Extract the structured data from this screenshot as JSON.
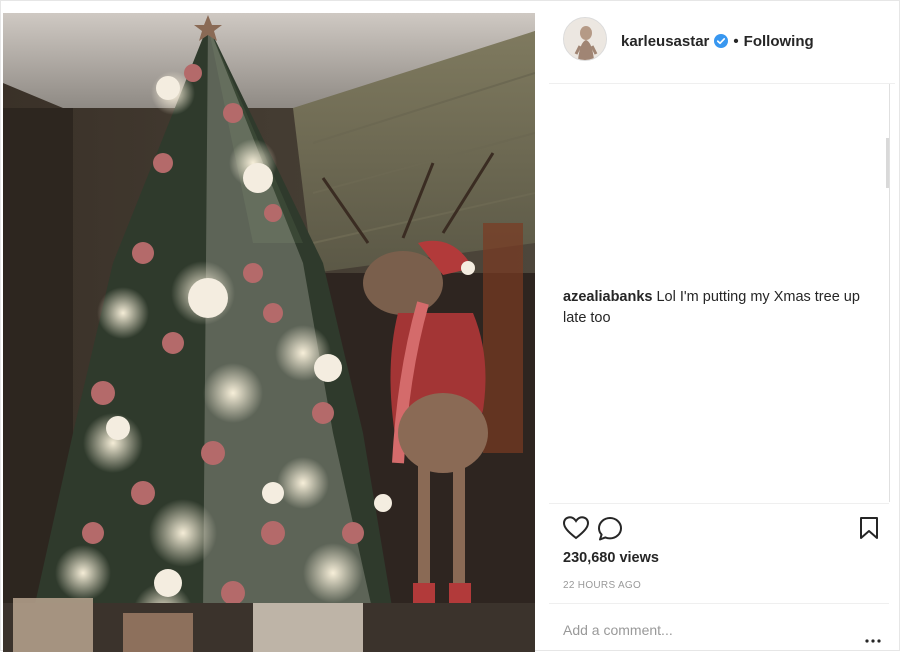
{
  "header": {
    "username": "karleusastar",
    "separator": "•",
    "follow_state": "Following",
    "verified_color": "#3897f0"
  },
  "comments": [
    {
      "author": "azealiabanks",
      "text": "Lol I'm putting my Xmas tree up late too"
    }
  ],
  "actions": {
    "icons": [
      "heart-icon",
      "comment-icon",
      "bookmark-icon"
    ],
    "views": "230,680 views",
    "timestamp": "22 HOURS AGO"
  },
  "add_comment": {
    "placeholder": "Add a comment...",
    "more_icon": "more-icon"
  },
  "colors": {
    "text": "#262626",
    "muted": "#999999",
    "border": "#efefef"
  }
}
